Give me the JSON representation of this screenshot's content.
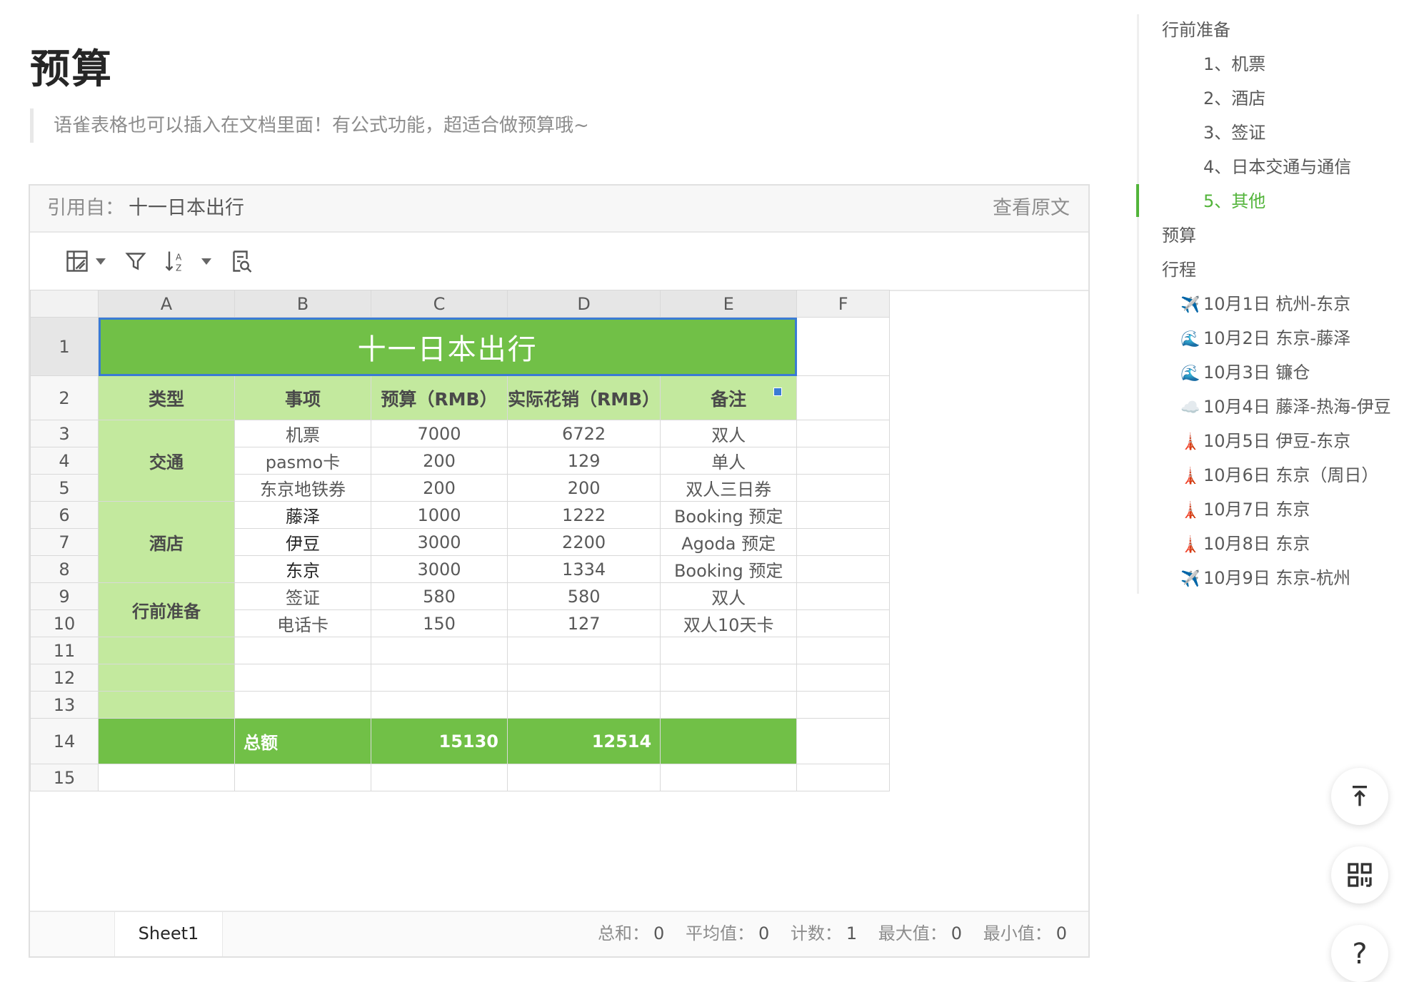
{
  "doc": {
    "title": "预算",
    "quote": "语雀表格也可以插入在文档里面！有公式功能，超适合做预算哦~"
  },
  "ref_bar": {
    "label": "引用自：",
    "name": "十一日本出行",
    "view_source": "查看原文"
  },
  "toolbar": {
    "icons": [
      "table-style-icon",
      "filter-icon",
      "sort-az-icon",
      "find-icon"
    ]
  },
  "sheet": {
    "columns": [
      "A",
      "B",
      "C",
      "D",
      "E",
      "F"
    ],
    "rows": [
      "1",
      "2",
      "3",
      "4",
      "5",
      "6",
      "7",
      "8",
      "9",
      "10",
      "11",
      "12",
      "13",
      "14",
      "15"
    ],
    "title": "十一日本出行",
    "headers": [
      "类型",
      "事项",
      "预算（RMB）",
      "实际花销（RMB）",
      "备注"
    ],
    "categories": [
      "交通",
      "酒店",
      "行前准备"
    ],
    "items": [
      {
        "name": "机票",
        "budget": "7000",
        "actual": "6722",
        "note": "双人"
      },
      {
        "name": "pasmo卡",
        "budget": "200",
        "actual": "129",
        "note": "单人"
      },
      {
        "name": "东京地铁券",
        "budget": "200",
        "actual": "200",
        "note": "双人三日券"
      },
      {
        "name": "藤泽",
        "budget": "1000",
        "actual": "1222",
        "note": "Booking 预定"
      },
      {
        "name": "伊豆",
        "budget": "3000",
        "actual": "2200",
        "note": "Agoda 预定"
      },
      {
        "name": "东京",
        "budget": "3000",
        "actual": "1334",
        "note": "Booking 预定"
      },
      {
        "name": "签证",
        "budget": "580",
        "actual": "580",
        "note": "双人"
      },
      {
        "name": "电话卡",
        "budget": "150",
        "actual": "127",
        "note": "双人10天卡"
      }
    ],
    "total": {
      "label": "总额",
      "budget": "15130",
      "actual": "12514"
    },
    "tab": "Sheet1",
    "stats": {
      "sum_label": "总和：",
      "sum": "0",
      "avg_label": "平均值：",
      "avg": "0",
      "count_label": "计数：",
      "count": "1",
      "max_label": "最大值：",
      "max": "0",
      "min_label": "最小值：",
      "min": "0"
    }
  },
  "toc": {
    "items": [
      {
        "label": "行前准备"
      },
      {
        "label": "1、机票"
      },
      {
        "label": "2、酒店"
      },
      {
        "label": "3、签证"
      },
      {
        "label": "4、日本交通与通信"
      },
      {
        "label": "5、其他",
        "active": true
      },
      {
        "label": "预算"
      },
      {
        "label": "行程"
      },
      {
        "label": "10月1日 杭州-东京",
        "emoji": "✈️"
      },
      {
        "label": "10月2日 东京-藤泽",
        "emoji": "🌊"
      },
      {
        "label": "10月3日 镰仓",
        "emoji": "🌊"
      },
      {
        "label": "10月4日 藤泽-热海-伊豆",
        "emoji": "☁️"
      },
      {
        "label": "10月5日 伊豆-东京",
        "emoji": "🗼"
      },
      {
        "label": "10月6日 东京（周日）",
        "emoji": "🗼"
      },
      {
        "label": "10月7日 东京",
        "emoji": "🗼"
      },
      {
        "label": "10月8日 东京",
        "emoji": "🗼"
      },
      {
        "label": "10月9日 东京-杭州",
        "emoji": "✈️"
      }
    ]
  },
  "float_buttons": {
    "help": "?"
  },
  "colors": {
    "title_green": "#71c047",
    "header_green": "#c3e99e",
    "toc_active": "#52b43a",
    "selection_blue": "#3a7bd5"
  }
}
